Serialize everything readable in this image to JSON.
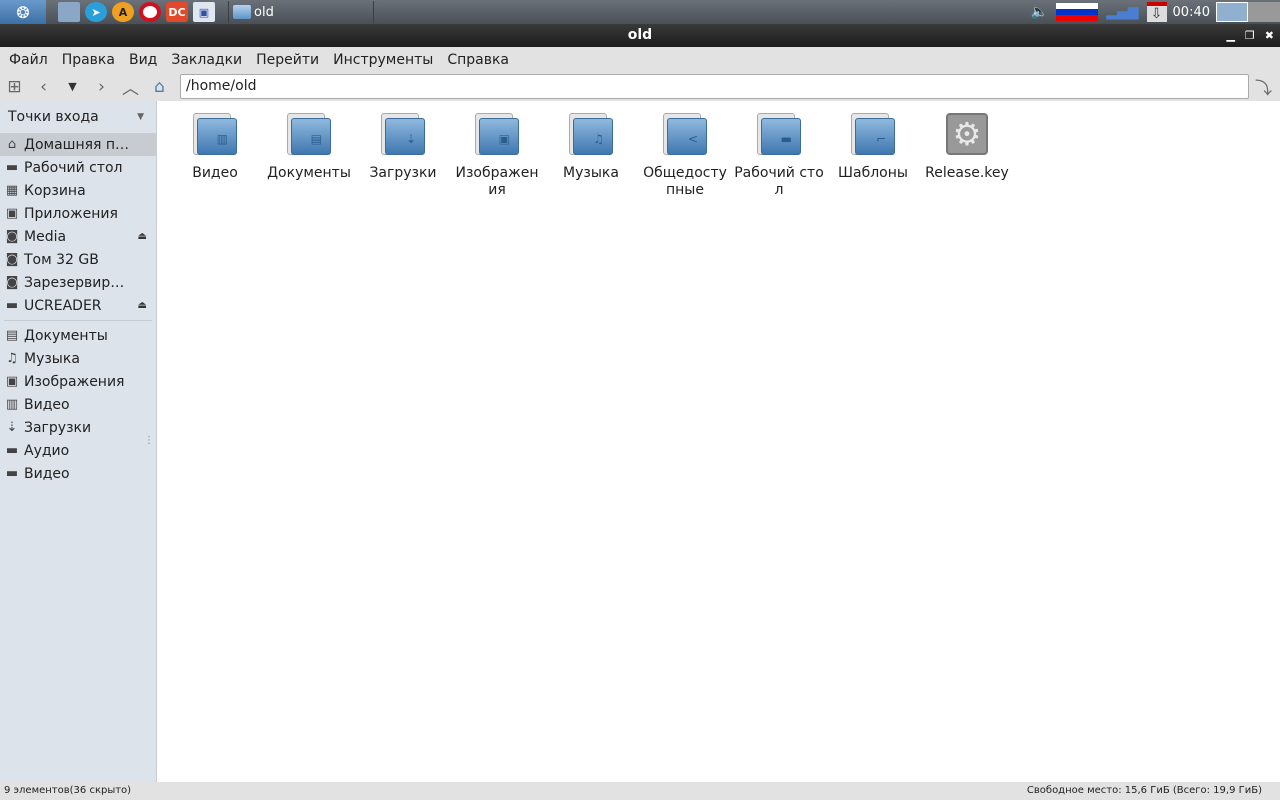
{
  "taskbar": {
    "task_label": "old",
    "clock": "00:40"
  },
  "window": {
    "title": "old"
  },
  "menu": [
    "Файл",
    "Правка",
    "Вид",
    "Закладки",
    "Перейти",
    "Инструменты",
    "Справка"
  ],
  "toolbar": {
    "path": "/home/old"
  },
  "sidebar": {
    "header": "Точки входа",
    "places": [
      {
        "label": "Домашняя п…",
        "icon": "⌂"
      },
      {
        "label": "Рабочий стол",
        "icon": "▬"
      },
      {
        "label": "Корзина",
        "icon": "▦"
      },
      {
        "label": "Приложения",
        "icon": "▣"
      },
      {
        "label": "Media",
        "icon": "◙",
        "eject": true
      },
      {
        "label": "Том 32 GB",
        "icon": "◙"
      },
      {
        "label": "Зарезервир…",
        "icon": "◙"
      },
      {
        "label": "UCREADER",
        "icon": "▬",
        "eject": true
      }
    ],
    "bookmarks": [
      {
        "label": "Документы",
        "icon": "▤"
      },
      {
        "label": "Музыка",
        "icon": "♫"
      },
      {
        "label": "Изображения",
        "icon": "▣"
      },
      {
        "label": "Видео",
        "icon": "▥"
      },
      {
        "label": "Загрузки",
        "icon": "⇣"
      },
      {
        "label": "Аудио",
        "icon": "▬"
      },
      {
        "label": "Видео",
        "icon": "▬"
      }
    ]
  },
  "files": [
    {
      "name": "Видео",
      "glyph": "▥"
    },
    {
      "name": "Документы",
      "glyph": "▤"
    },
    {
      "name": "Загрузки",
      "glyph": "⇣"
    },
    {
      "name": "Изображения",
      "glyph": "▣"
    },
    {
      "name": "Музыка",
      "glyph": "♫"
    },
    {
      "name": "Общедоступные",
      "glyph": "<"
    },
    {
      "name": "Рабочий стол",
      "glyph": "▬"
    },
    {
      "name": "Шаблоны",
      "glyph": "⌐"
    },
    {
      "name": "Release.key",
      "glyph": "⚙",
      "type": "file"
    }
  ],
  "status": {
    "left": "9 элементов(36 скрыто)",
    "right": "Свободное место: 15,6 ГиБ (Всего: 19,9 ГиБ)"
  }
}
